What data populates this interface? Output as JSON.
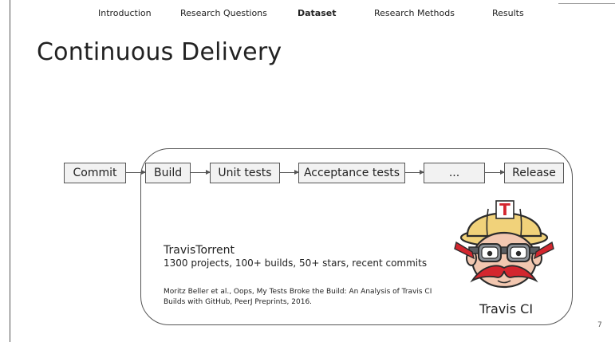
{
  "nav": {
    "items": [
      "Introduction",
      "Research Questions",
      "Dataset",
      "Research Methods",
      "Results"
    ],
    "active": "Dataset"
  },
  "slide": {
    "title": "Continuous Delivery",
    "page_number": "7"
  },
  "pipeline": {
    "stages": [
      "Commit",
      "Build",
      "Unit tests",
      "Acceptance tests",
      "...",
      "Release"
    ]
  },
  "dataset": {
    "name": "TravisTorrent",
    "description": "1300 projects, 100+ builds, 50+ stars, recent commits",
    "citation": "Moritz Beller et al., Oops, My Tests Broke the Build: An Analysis of Travis CI Builds with GitHub, PeerJ Preprints, 2016."
  },
  "logo": {
    "label": "Travis CI",
    "helmet_letter": "T",
    "icon": "travis-ci-mascot-icon"
  },
  "colors": {
    "helmet_yellow": "#f1d27a",
    "helmet_red": "#d3262e",
    "skin": "#f2c7b0",
    "goggle_gray": "#8c9197",
    "stage_fill": "#f2f2f2",
    "border": "#555555"
  }
}
